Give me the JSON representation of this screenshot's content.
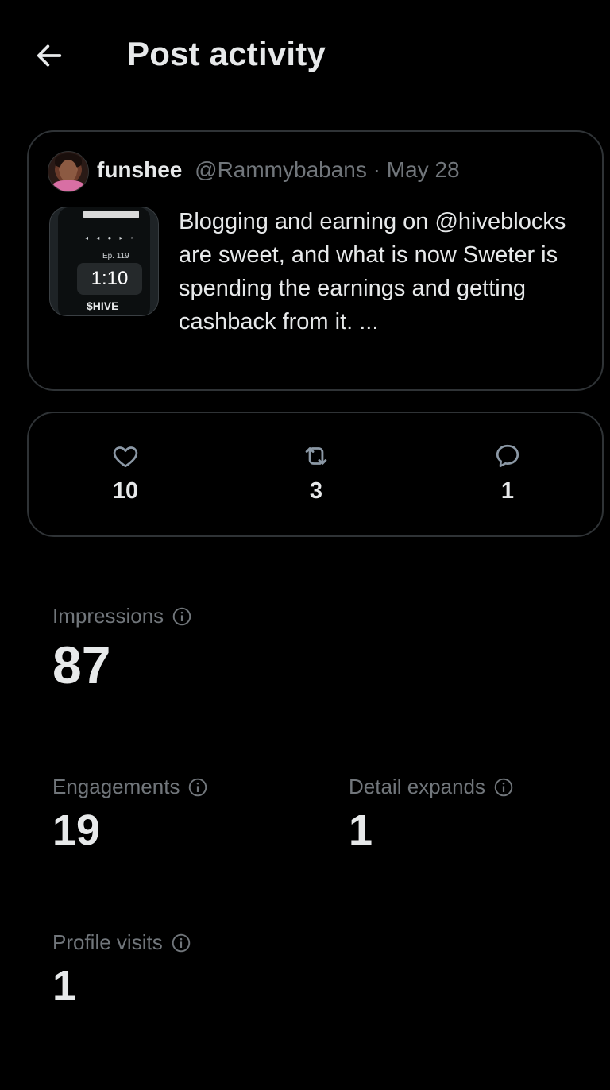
{
  "header": {
    "title": "Post activity",
    "back_icon": "arrow-left-icon"
  },
  "post": {
    "author_name": "funshee",
    "author_handle": "@Rammybabans",
    "separator": "·",
    "date": "May 28",
    "text": "Blogging and earning on @hiveblocks are sweet, and what is now  Sweter is spending the earnings and getting cashback from it. ...",
    "media": {
      "episode": "Ep. 119",
      "duration": "1:10",
      "ticker": "$HIVE"
    }
  },
  "engagement": {
    "likes": "10",
    "reposts": "3",
    "replies": "1"
  },
  "metrics": {
    "impressions": {
      "label": "Impressions",
      "value": "87"
    },
    "engagements": {
      "label": "Engagements",
      "value": "19"
    },
    "detail_expands": {
      "label": "Detail expands",
      "value": "1"
    },
    "profile_visits": {
      "label": "Profile visits",
      "value": "1"
    }
  },
  "colors": {
    "background": "#000000",
    "text": "#e7e9ea",
    "muted": "#71767b",
    "border": "#2f3336"
  }
}
